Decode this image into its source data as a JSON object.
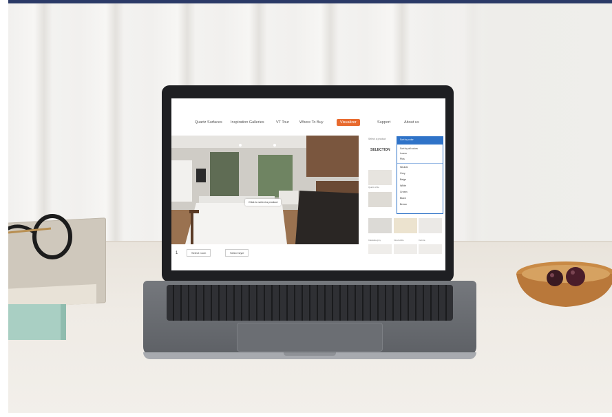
{
  "nav": {
    "items": [
      {
        "label": "Quartz Surfaces",
        "active": false
      },
      {
        "label": "Inspiration Galleries",
        "active": false
      },
      {
        "label": "VT Tour",
        "active": false
      },
      {
        "label": "Where To Buy",
        "active": false
      },
      {
        "label": "Visualizer",
        "active": true
      },
      {
        "label": "Support",
        "active": false
      },
      {
        "label": "About us",
        "active": false
      }
    ]
  },
  "visualizer": {
    "room_button": "Click to select a product",
    "page_number": "1",
    "bottom_buttons": [
      "Select room",
      "Select style"
    ],
    "side_label": "Select a product",
    "side_title": "SELECTION",
    "dropdown_selected": "Sort by color",
    "dropdown_items": [
      "Sort by all colors",
      "Lorem",
      "Plus",
      "Neutral",
      "Grey",
      "Beige",
      "White",
      "Cream",
      "Black",
      "Brown"
    ],
    "tile_labels": [
      "Quartz white",
      "Calacatta grey",
      "Cloud white",
      "Carrara"
    ]
  },
  "colors": {
    "accent": "#e86a2e",
    "dropdown": "#2f73c8",
    "top_strip": "#2b3a67"
  }
}
